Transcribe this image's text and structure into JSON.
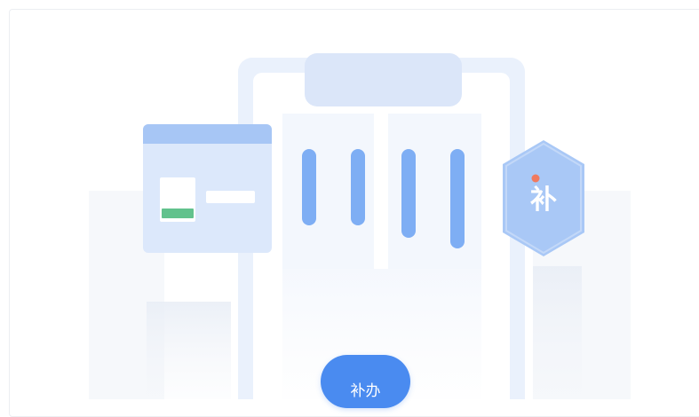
{
  "badge": {
    "label": "补",
    "fill": "#a9c8f6",
    "text_color": "#ffffff",
    "dot_color": "#f07a5f"
  },
  "action": {
    "label": "补办"
  },
  "colors": {
    "accent": "#4a8bf0",
    "bar": "#7eaef4",
    "panel": "#dce8fb",
    "panel_header": "#a7c6f5",
    "green": "#62c28d"
  }
}
